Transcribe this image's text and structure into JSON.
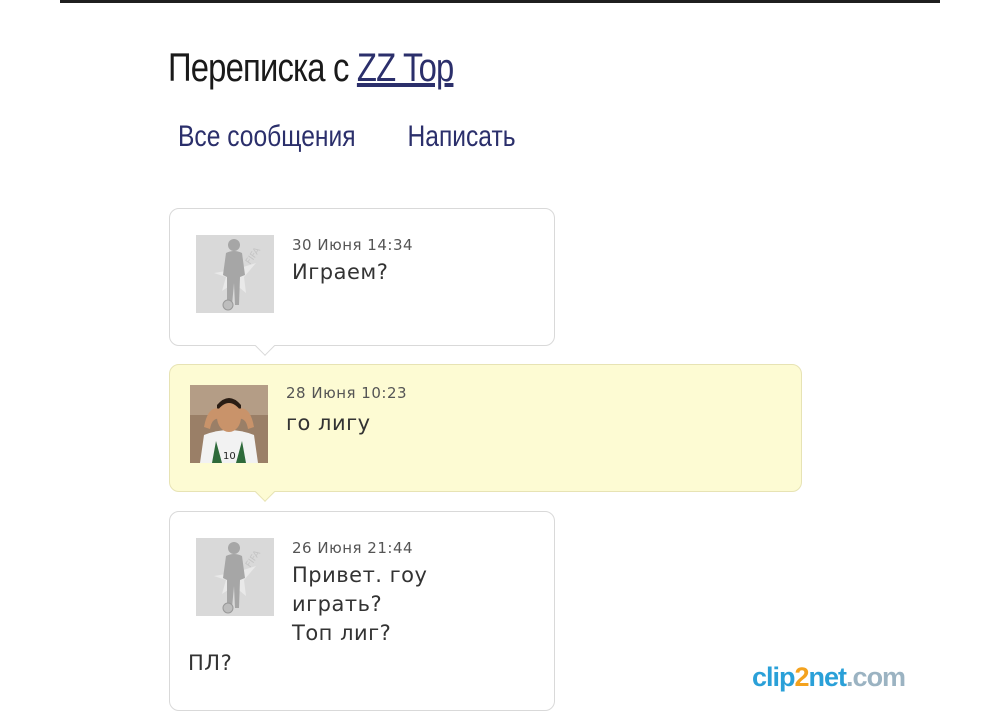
{
  "header": {
    "title_prefix": "Переписка с",
    "contact_name": "ZZ Top"
  },
  "nav": {
    "all_messages": "Все сообщения",
    "write": "Написать"
  },
  "messages": [
    {
      "date": "30 Июня 14:34",
      "text": "Играем?",
      "own": false
    },
    {
      "date": "28 Июня 10:23",
      "text": "го лигу",
      "own": true
    },
    {
      "date": "26 Июня 21:44",
      "text": "Привет. гоу\nиграть?\nТоп лиг?",
      "text_tail": "ПЛ?",
      "own": false
    }
  ],
  "watermark": {
    "text": "clip2net.com"
  },
  "colors": {
    "link": "#2b2f6b",
    "own_bubble": "#fdfbd3",
    "other_bubble": "#ffffff"
  }
}
